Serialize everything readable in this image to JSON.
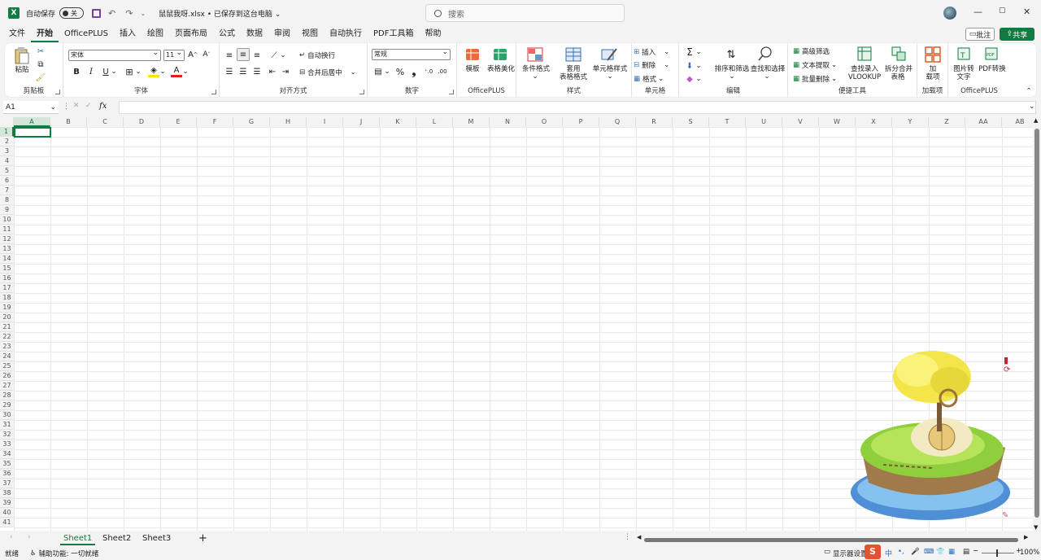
{
  "titlebar": {
    "autosave_label": "自动保存",
    "autosave_state": "关",
    "filename": "鼠鼠我呀.xlsx • 已保存到这台电脑 ⌄",
    "search_placeholder": "搜索"
  },
  "menu": {
    "items": [
      "文件",
      "开始",
      "OfficePLUS",
      "插入",
      "绘图",
      "页面布局",
      "公式",
      "数据",
      "审阅",
      "视图",
      "自动执行",
      "PDF工具箱",
      "帮助"
    ],
    "active": "开始",
    "comment_label": "批注",
    "share_label": "共享"
  },
  "ribbon": {
    "clipboard": {
      "label": "剪贴板",
      "paste": "粘贴"
    },
    "font": {
      "label": "字体",
      "font_name": "宋体",
      "font_size": "11",
      "bold": "B",
      "italic": "I",
      "underline": "U"
    },
    "alignment": {
      "label": "对齐方式",
      "wrap": "自动换行",
      "merge": "合并后居中"
    },
    "number": {
      "label": "数字",
      "format": "常规",
      "percent": "%",
      "comma": "❟"
    },
    "officeplus1": {
      "label": "OfficePLUS",
      "template": "模板",
      "beautify": "表格美化"
    },
    "styles": {
      "label": "样式",
      "conditional": "条件格式",
      "table_format_line1": "套用",
      "table_format_line2": "表格格式",
      "cell_styles": "单元格样式"
    },
    "cells": {
      "label": "单元格",
      "insert": "插入",
      "delete": "删除",
      "format": "格式"
    },
    "editing": {
      "label": "编辑",
      "sort_filter": "排序和筛选",
      "find_select": "查找和选择"
    },
    "tools": {
      "label": "便捷工具",
      "advanced_filter": "高级筛选",
      "text_extract": "文本提取",
      "batch_delete": "批量删除",
      "vlookup_line1": "查找录入",
      "vlookup_line2": "VLOOKUP",
      "split_merge_line1": "拆分合并",
      "split_merge_line2": "表格"
    },
    "addins": {
      "label": "加载项",
      "addins_line1": "加",
      "addins_line2": "载项"
    },
    "officeplus2": {
      "label": "OfficePLUS",
      "img2text_line1": "图片转",
      "img2text_line2": "文字",
      "pdf_line1": "PDF转换",
      "pdf_line2": ""
    }
  },
  "formula": {
    "namebox": "A1",
    "fx": "fx"
  },
  "columns": [
    "A",
    "B",
    "C",
    "D",
    "E",
    "F",
    "G",
    "H",
    "I",
    "J",
    "K",
    "L",
    "M",
    "N",
    "O",
    "P",
    "Q",
    "R",
    "S",
    "T",
    "U",
    "V",
    "W",
    "X",
    "Y",
    "Z",
    "AA",
    "AB"
  ],
  "rows": [
    "1",
    "2",
    "3",
    "4",
    "5",
    "6",
    "7",
    "8",
    "9",
    "10",
    "11",
    "12",
    "13",
    "14",
    "15",
    "16",
    "17",
    "18",
    "19",
    "20",
    "21",
    "22",
    "23",
    "24",
    "25",
    "26",
    "27",
    "28",
    "29",
    "30",
    "31",
    "32",
    "33",
    "34",
    "35",
    "36",
    "37",
    "38",
    "39",
    "40",
    "41"
  ],
  "sheets": {
    "tabs": [
      "Sheet1",
      "Sheet2",
      "Sheet3"
    ],
    "active": "Sheet1",
    "add": "+"
  },
  "status": {
    "ready": "就绪",
    "accessibility": "辅助功能: 一切就绪",
    "display_settings": "显示器设置",
    "zoom": "100%",
    "ime": "中"
  }
}
